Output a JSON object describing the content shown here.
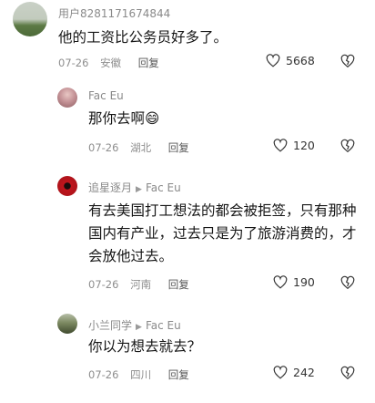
{
  "comments": [
    {
      "user": "用户8281171674844",
      "reply_to": "",
      "text": "他的工资比公务员好多了。",
      "date": "07-26",
      "location": "安徽",
      "reply_label": "回复",
      "likes": "5668",
      "avatar_color": "#7d8f6a"
    },
    {
      "user": "Fac Eu",
      "reply_to": "",
      "text": "那你去啊😄",
      "date": "07-26",
      "location": "湖北",
      "reply_label": "回复",
      "likes": "120",
      "avatar_color": "#b9868b"
    },
    {
      "user": "追星逐月",
      "reply_to": "Fac Eu",
      "text": "有去美国打工想法的都会被拒签，只有那种国内有产业，过去只是为了旅游消费的，才会放他过去。",
      "date": "07-26",
      "location": "河南",
      "reply_label": "回复",
      "likes": "190",
      "avatar_color": "#c0151c"
    },
    {
      "user": "小兰同学",
      "reply_to": "Fac Eu",
      "text": "你以为想去就去？",
      "date": "07-26",
      "location": "四川",
      "reply_label": "回复",
      "likes": "242",
      "avatar_color": "#5f6a4e"
    }
  ]
}
